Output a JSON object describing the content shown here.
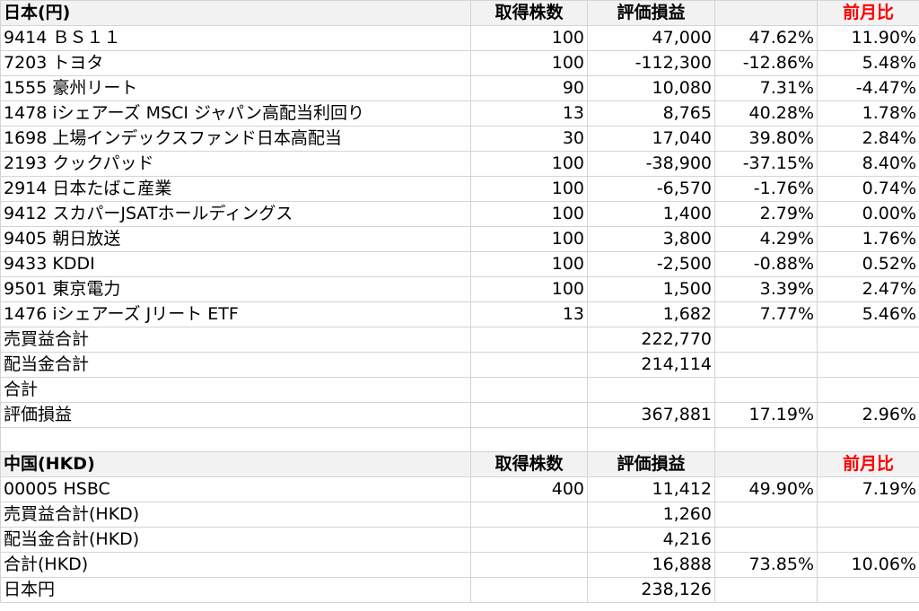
{
  "colors": {
    "positive": "#ff0000",
    "negative": "#4f81bd",
    "header_bg": "#f2f2f2",
    "grid": "#d4d4d4"
  },
  "japan": {
    "header": {
      "title": "日本(円)",
      "shares": "取得株数",
      "valuation": "評価損益",
      "pct": "",
      "mom": "前月比"
    },
    "rows": [
      {
        "name": "9414 ＢＳ１１",
        "shares": "100",
        "gain": "47,000",
        "pct": "47.62%",
        "mom": "11.90%",
        "gain_sign": "pos",
        "pct_sign": "pos",
        "mom_sign": "pos"
      },
      {
        "name": "7203 トヨタ",
        "shares": "100",
        "gain": "-112,300",
        "pct": "-12.86%",
        "mom": "5.48%",
        "gain_sign": "neg",
        "pct_sign": "neg",
        "mom_sign": "pos"
      },
      {
        "name": "1555 豪州リート",
        "shares": "90",
        "gain": "10,080",
        "pct": "7.31%",
        "mom": "-4.47%",
        "gain_sign": "pos",
        "pct_sign": "pos",
        "mom_sign": "neg"
      },
      {
        "name": "1478 iシェアーズ MSCI ジャパン高配当利回り",
        "shares": "13",
        "gain": "8,765",
        "pct": "40.28%",
        "mom": "1.78%",
        "gain_sign": "pos",
        "pct_sign": "pos",
        "mom_sign": "pos"
      },
      {
        "name": "1698 上場インデックスファンド日本高配当",
        "shares": "30",
        "gain": "17,040",
        "pct": "39.80%",
        "mom": "2.84%",
        "gain_sign": "pos",
        "pct_sign": "pos",
        "mom_sign": "pos"
      },
      {
        "name": "2193 クックパッド",
        "shares": "100",
        "gain": "-38,900",
        "pct": "-37.15%",
        "mom": "8.40%",
        "gain_sign": "neg",
        "pct_sign": "neg",
        "mom_sign": "pos"
      },
      {
        "name": "2914 日本たばこ産業",
        "shares": "100",
        "gain": "-6,570",
        "pct": "-1.76%",
        "mom": "0.74%",
        "gain_sign": "neg",
        "pct_sign": "neg",
        "mom_sign": "pos"
      },
      {
        "name": "9412 スカパーJSATホールディングス",
        "shares": "100",
        "gain": "1,400",
        "pct": "2.79%",
        "mom": "0.00%",
        "gain_sign": "pos",
        "pct_sign": "pos",
        "mom_sign": "blk"
      },
      {
        "name": "9405 朝日放送",
        "shares": "100",
        "gain": "3,800",
        "pct": "4.29%",
        "mom": "1.76%",
        "gain_sign": "pos",
        "pct_sign": "pos",
        "mom_sign": "pos"
      },
      {
        "name": "9433 KDDI",
        "shares": "100",
        "gain": "-2,500",
        "pct": "-0.88%",
        "mom": "0.52%",
        "gain_sign": "neg",
        "pct_sign": "neg",
        "mom_sign": "pos"
      },
      {
        "name": "9501 東京電力",
        "shares": "100",
        "gain": "1,500",
        "pct": "3.39%",
        "mom": "2.47%",
        "gain_sign": "pos",
        "pct_sign": "pos",
        "mom_sign": "pos"
      },
      {
        "name": "1476 iシェアーズ Jリート ETF",
        "shares": "13",
        "gain": "1,682",
        "pct": "7.77%",
        "mom": "5.46%",
        "gain_sign": "pos",
        "pct_sign": "pos",
        "mom_sign": "pos"
      }
    ],
    "summary": [
      {
        "name": "売買益合計",
        "gain": "222,770",
        "pct": "",
        "mom": ""
      },
      {
        "name": "配当金合計",
        "gain": "214,114",
        "pct": "",
        "mom": ""
      },
      {
        "name": "合計",
        "gain": "",
        "pct": "",
        "mom": ""
      },
      {
        "name": "評価損益",
        "gain": "367,881",
        "pct": "17.19%",
        "mom": "2.96%"
      }
    ]
  },
  "china": {
    "header": {
      "title": "中国(HKD)",
      "shares": "取得株数",
      "valuation": "評価損益",
      "pct": "",
      "mom": "前月比"
    },
    "rows": [
      {
        "name": "00005 HSBC",
        "shares": "400",
        "gain": "11,412",
        "pct": "49.90%",
        "mom": "7.19%",
        "gain_sign": "pos",
        "pct_sign": "pos",
        "mom_sign": "pos"
      }
    ],
    "summary": [
      {
        "name": "売買益合計(HKD)",
        "gain": "1,260",
        "pct": "",
        "mom": ""
      },
      {
        "name": "配当金合計(HKD)",
        "gain": "4,216",
        "pct": "",
        "mom": ""
      },
      {
        "name": "合計(HKD)",
        "gain": "16,888",
        "pct": "73.85%",
        "mom": "10.06%"
      },
      {
        "name": "日本円",
        "gain": "238,126",
        "pct": "",
        "mom": ""
      }
    ]
  }
}
